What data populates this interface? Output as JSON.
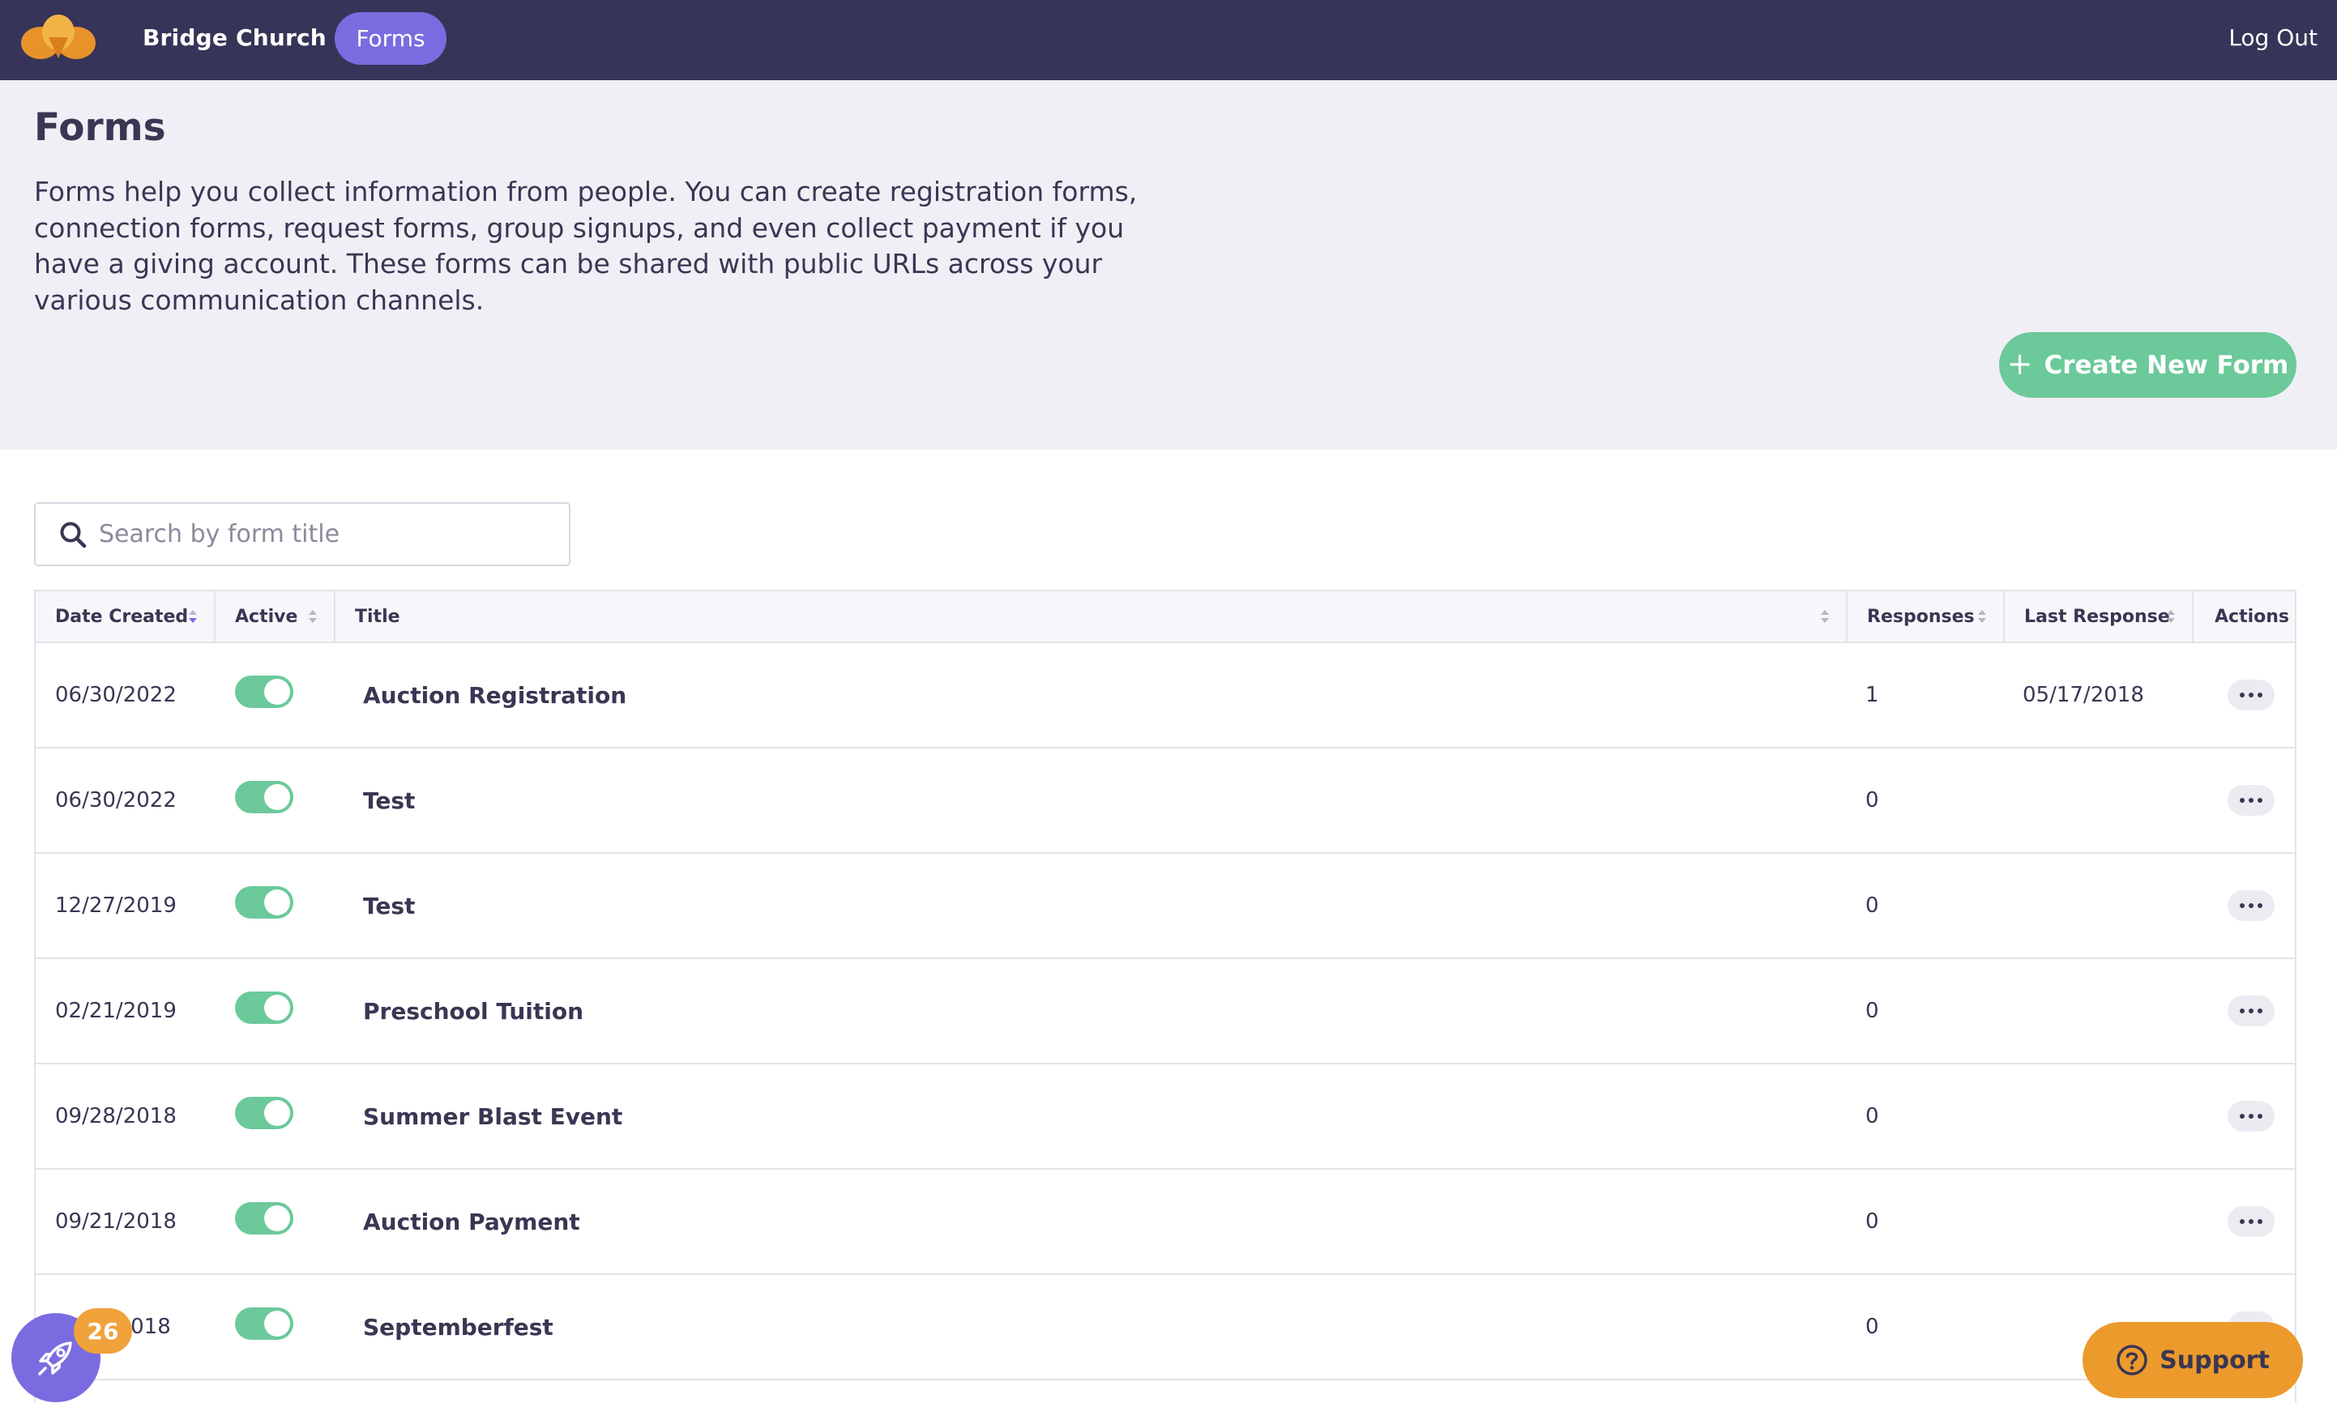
{
  "nav": {
    "org_name": "Bridge Church",
    "active_tab": "Forms",
    "logout": "Log Out"
  },
  "header": {
    "title": "Forms",
    "description": "Forms help you collect information from people. You can create registration forms, connection forms, request forms, group signups, and even collect payment if you have a giving account. These forms can be shared with public URLs across your various communication channels.",
    "create_button": "Create New Form"
  },
  "search": {
    "placeholder": "Search by form title"
  },
  "table": {
    "columns": [
      "Date Created",
      "Active",
      "Title",
      "Responses",
      "Last Response",
      "Actions"
    ],
    "sorted_column": "Date Created",
    "rows": [
      {
        "date": "06/30/2022",
        "active": true,
        "title": "Auction Registration",
        "responses": "1",
        "last_response": "05/17/2018"
      },
      {
        "date": "06/30/2022",
        "active": true,
        "title": "Test",
        "responses": "0",
        "last_response": ""
      },
      {
        "date": "12/27/2019",
        "active": true,
        "title": "Test",
        "responses": "0",
        "last_response": ""
      },
      {
        "date": "02/21/2019",
        "active": true,
        "title": "Preschool Tuition",
        "responses": "0",
        "last_response": ""
      },
      {
        "date": "09/28/2018",
        "active": true,
        "title": "Summer Blast Event",
        "responses": "0",
        "last_response": ""
      },
      {
        "date": "09/21/2018",
        "active": true,
        "title": "Auction Payment",
        "responses": "0",
        "last_response": ""
      },
      {
        "date": "09/…/2018",
        "active": true,
        "title": "Septemberfest",
        "responses": "0",
        "last_response": ""
      }
    ]
  },
  "floating": {
    "rocket_badge": "26",
    "support_label": "Support"
  },
  "colors": {
    "nav_bg": "#363458",
    "accent_purple": "#7a6ce0",
    "toggle_green": "#6bc99a",
    "support_orange": "#ec9a2c",
    "badge_orange": "#f0a23b",
    "hero_bg": "#f0eff6"
  }
}
